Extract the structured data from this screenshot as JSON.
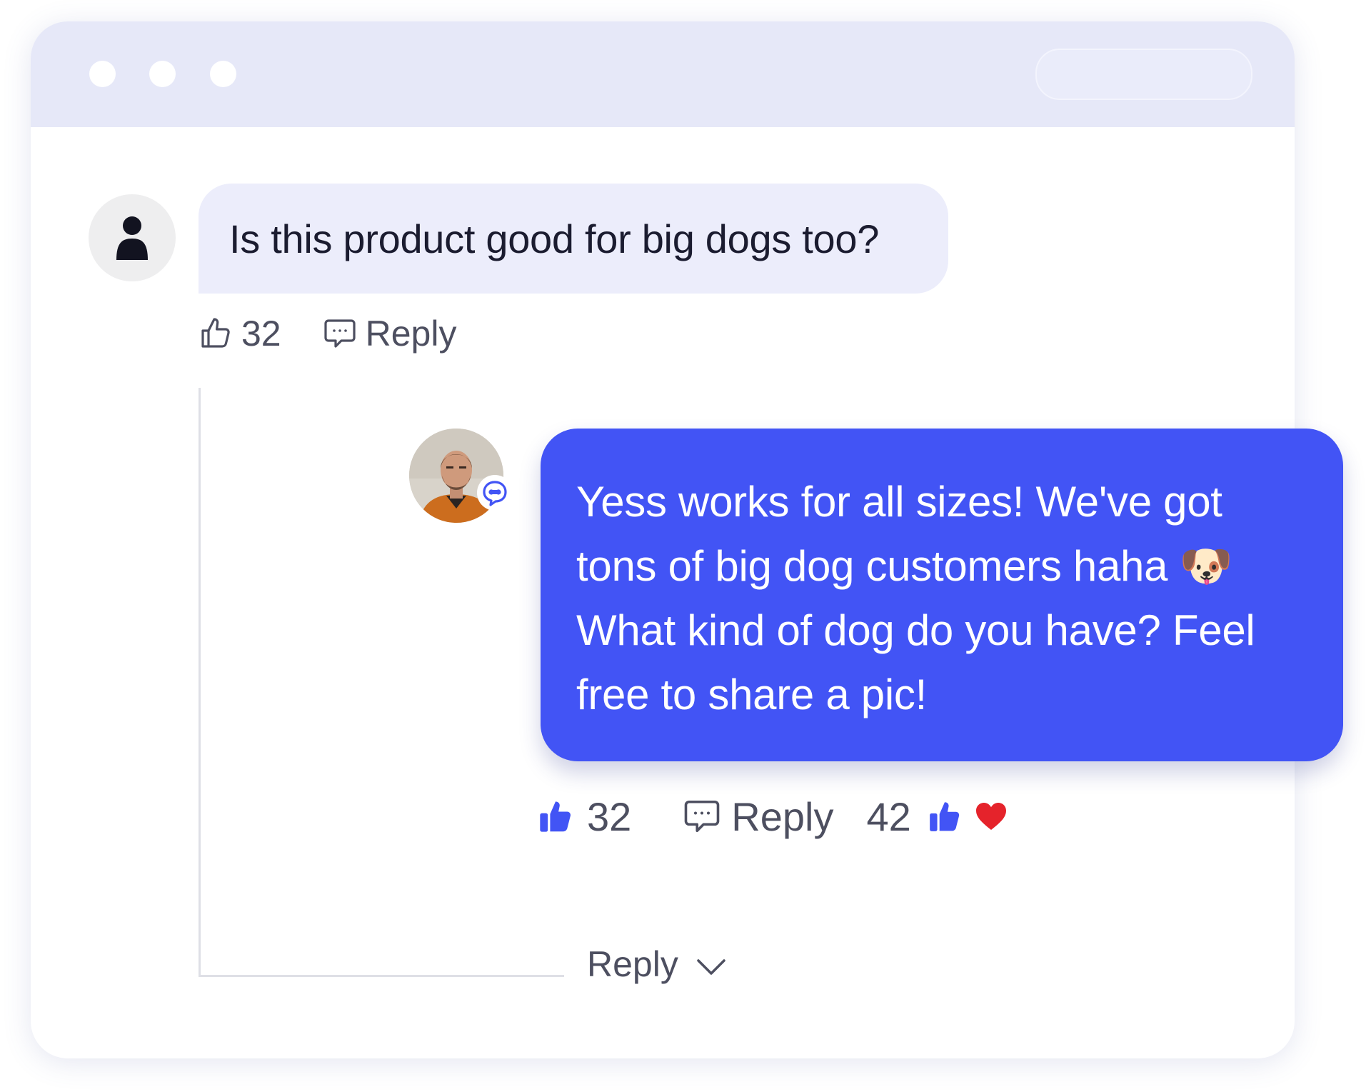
{
  "window": {
    "traffic_lights": [
      "dot",
      "dot",
      "dot"
    ]
  },
  "question": {
    "text": "Is this product good for big dogs too?",
    "avatar_icon": "user-silhouette-icon",
    "likes": "32",
    "reply_label": "Reply"
  },
  "answer": {
    "lines": [
      "Yess works for all sizes! We've got",
      "tons of big dog customers haha 🐶",
      "What kind of dog do you have? Feel",
      "free to share a pic!"
    ],
    "avatar_icon": "agent-photo",
    "badge_icon": "chat-bot-badge-icon",
    "likes": "32",
    "reply_label": "Reply",
    "reaction_count": "42",
    "reactions": [
      "thumbs-up-icon",
      "heart-icon"
    ]
  },
  "thread": {
    "collapse_label": "Reply",
    "collapse_icon": "chevron-down-icon"
  },
  "colors": {
    "accent": "#4254F5",
    "titlebar": "#E6E8F8",
    "question_bubble": "#ECEDFB",
    "heart": "#E5232B",
    "muted_text": "#4D4F60"
  }
}
